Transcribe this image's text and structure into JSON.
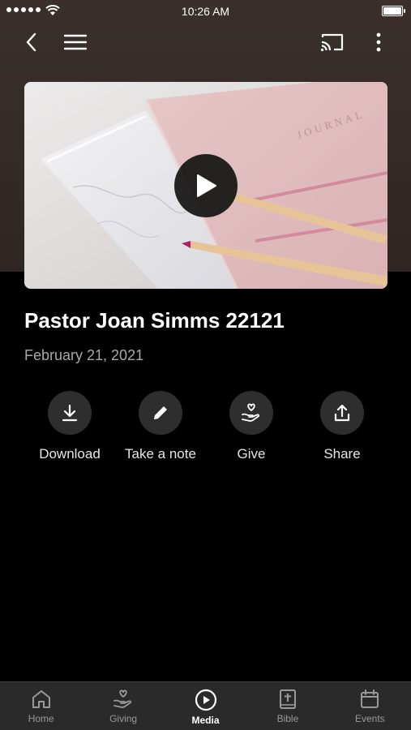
{
  "status_bar": {
    "time": "10:26 AM"
  },
  "nav": {
    "back": "chevron-left-icon",
    "menu": "hamburger-menu-icon",
    "cast": "cast-icon",
    "more": "more-vertical-icon"
  },
  "video": {
    "cover_text": "JOURNAL",
    "play": "play-icon"
  },
  "sermon": {
    "title": "Pastor Joan Simms 22121",
    "date": "February 21, 2021"
  },
  "actions": [
    {
      "label": "Download",
      "icon": "download-icon"
    },
    {
      "label": "Take a note",
      "icon": "pencil-icon"
    },
    {
      "label": "Give",
      "icon": "giving-hand-icon"
    },
    {
      "label": "Share",
      "icon": "share-icon"
    }
  ],
  "tabs": [
    {
      "label": "Home",
      "icon": "home-icon",
      "active": false
    },
    {
      "label": "Giving",
      "icon": "giving-hand-icon",
      "active": false
    },
    {
      "label": "Media",
      "icon": "play-circle-icon",
      "active": true
    },
    {
      "label": "Bible",
      "icon": "bible-icon",
      "active": false
    },
    {
      "label": "Events",
      "icon": "calendar-icon",
      "active": false
    }
  ],
  "colors": {
    "header_bg": "#3a2f2b",
    "page_bg": "#000000",
    "tab_bar_bg": "#2a2a2a",
    "action_circle": "#2e2e2e",
    "muted_text": "#a8a8a8"
  }
}
